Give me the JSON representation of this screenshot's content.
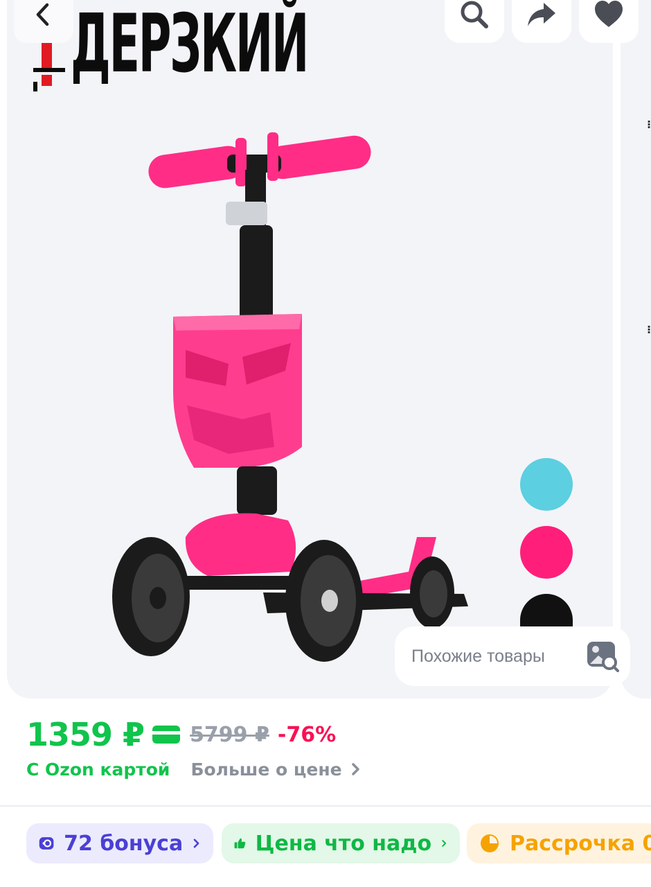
{
  "brand": {
    "name": "ДЕРЗКИЙ"
  },
  "colors": {
    "accent_pink": "#ff1f7a",
    "swatch_blue": "#5ccfe0",
    "swatch_pink": "#ff1f7a",
    "swatch_black": "#111111",
    "price_green": "#10c44c",
    "discount_red": "#f91155",
    "bonus_purple": "#4b3fd6",
    "installment_orange": "#f5a300"
  },
  "header": {
    "back_icon": "chevron-left-icon",
    "actions": [
      "search-icon",
      "share-icon",
      "heart-icon"
    ]
  },
  "gallery": {
    "similar_label": "Похожие товары",
    "similar_icon": "image-search-icon",
    "swatches": [
      "blue",
      "pink",
      "black"
    ]
  },
  "price": {
    "current": "1359 ₽",
    "old": "5799 ₽",
    "discount": "-76%",
    "card_note": "С Ozon картой",
    "more_link": "Больше о цене"
  },
  "badges": {
    "bonus": "72 бонуса",
    "good_price": "Цена что надо",
    "installment": "Рассрочка 0"
  }
}
